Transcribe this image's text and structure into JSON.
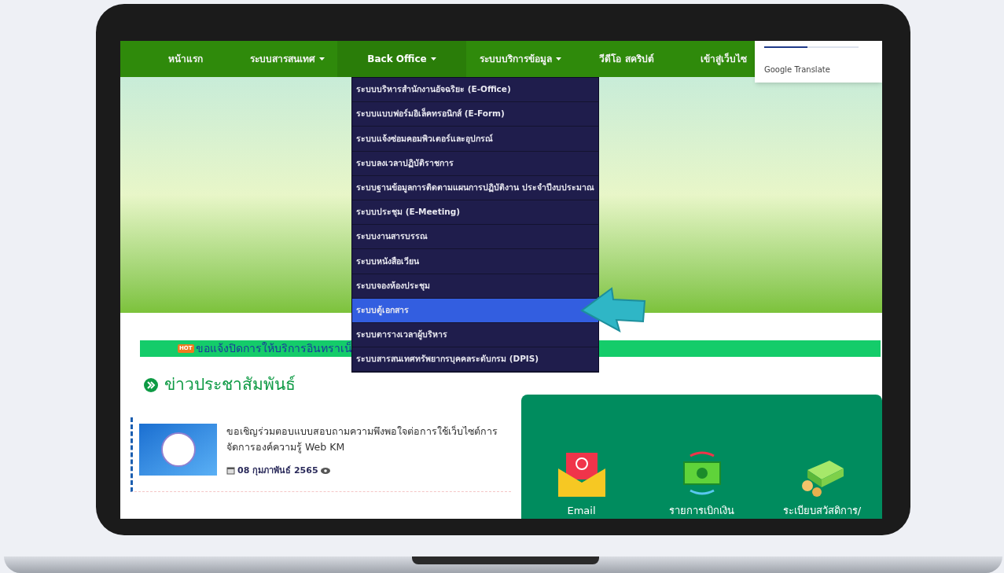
{
  "nav": [
    {
      "label": "หน้าแรก",
      "dropdown": false,
      "selected": false
    },
    {
      "label": "ระบบสารสนเทศ",
      "dropdown": true,
      "selected": false
    },
    {
      "label": "Back Office",
      "dropdown": true,
      "selected": true
    },
    {
      "label": "ระบบบริการข้อมูล",
      "dropdown": true,
      "selected": false
    },
    {
      "label": "วีดีโอ สคริปต์",
      "dropdown": false,
      "selected": false
    },
    {
      "label": "เข้าสู่เว็บไซ",
      "selected": false
    }
  ],
  "translate_popup": {
    "label": "Google Translate"
  },
  "dropdown_menu": [
    {
      "label": "ระบบบริหารสำนักงานอัจฉริยะ (E-Office)",
      "selected": false
    },
    {
      "label": "ระบบแบบฟอร์มอิเล็คทรอนิกส์ (E-Form)",
      "selected": false
    },
    {
      "label": "ระบบแจ้งซ่อมคอมพิวเตอร์และอุปกรณ์",
      "selected": false
    },
    {
      "label": "ระบบลงเวลาปฏิบัติราชการ",
      "selected": false
    },
    {
      "label": "ระบบฐานข้อมูลการติดตามแผนการปฏิบัติงาน ประจำปีงบประมาณ",
      "selected": false
    },
    {
      "label": "ระบบประชุม (E-Meeting)",
      "selected": false
    },
    {
      "label": "ระบบงานสารบรรณ",
      "selected": false
    },
    {
      "label": "ระบบหนังสือเวียน",
      "selected": false
    },
    {
      "label": "ระบบจองห้องประชุม",
      "selected": false
    },
    {
      "label": "ระบบตู้เอกสาร",
      "selected": true
    },
    {
      "label": "ระบบตารางเวลาผู้บริหาร",
      "selected": false
    },
    {
      "label": "ระบบสารสนเทศทรัพยากรบุคคลระดับกรม (DPIS)",
      "selected": false
    }
  ],
  "announcement": {
    "badge": "HOT",
    "text": "ขอแจ้งปิดการให้บริการอินทราเน็"
  },
  "news_section": {
    "title": "ข่าวประชาสัมพันธ์",
    "items": [
      {
        "title": "ขอเชิญร่วมตอบแบบสอบถามความพึงพอใจต่อการใช้เว็บไซต์การจัดการองค์ความรู้ Web KM",
        "date": "08 กุมภาพันธ์ 2565"
      }
    ]
  },
  "services": [
    {
      "kind": "email",
      "label": "Email"
    },
    {
      "kind": "transfer",
      "label": "รายการเบิกเงิน"
    },
    {
      "kind": "money",
      "label": "ระเบียบสวัสดิการ/"
    }
  ]
}
